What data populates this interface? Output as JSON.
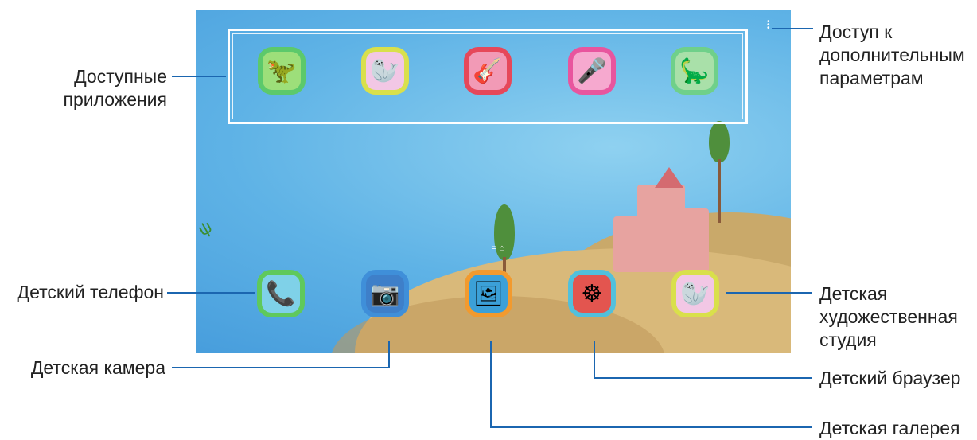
{
  "callouts": {
    "available_apps": "Доступные\nприложения",
    "more_options": "Доступ к\nдополнительным\nпараметрам",
    "kids_phone": "Детский телефон",
    "kids_camera": "Детская камера",
    "kids_art_studio": "Детская\nхудожественная\nстудия",
    "kids_browser": "Детский браузер",
    "kids_gallery": "Детская галерея"
  },
  "icons": {
    "top": [
      {
        "name": "dino-house-app",
        "glyph": "🦖",
        "border": "#5cc96b",
        "bg": "#9ddf7a"
      },
      {
        "name": "artist-app",
        "glyph": "🦭",
        "border": "#d9e04b",
        "bg": "#f2c7e5"
      },
      {
        "name": "music-app",
        "glyph": "🎸",
        "border": "#e6485a",
        "bg": "#f29ab6"
      },
      {
        "name": "sing-app",
        "glyph": "🎤",
        "border": "#e8559e",
        "bg": "#f6a9cf"
      },
      {
        "name": "dino-cook-app",
        "glyph": "🦕",
        "border": "#6fd08a",
        "bg": "#a9e0a9"
      }
    ],
    "bottom": [
      {
        "name": "phone-app",
        "glyph": "📞",
        "border": "#5fc95c",
        "bg": "#7fd1e8"
      },
      {
        "name": "camera-app",
        "glyph": "📷",
        "border": "#3f8fd9",
        "bg": "#3e7fc9"
      },
      {
        "name": "gallery-app",
        "glyph": "🖼",
        "border": "#f29a2e",
        "bg": "#3ba0d8"
      },
      {
        "name": "browser-app",
        "glyph": "☸",
        "border": "#52c0dc",
        "bg": "#e3554f"
      },
      {
        "name": "art-studio-app",
        "glyph": "🦭",
        "border": "#d9e04b",
        "bg": "#f2c7e5"
      }
    ]
  },
  "colors": {
    "leader_line": "#1b66b0"
  }
}
